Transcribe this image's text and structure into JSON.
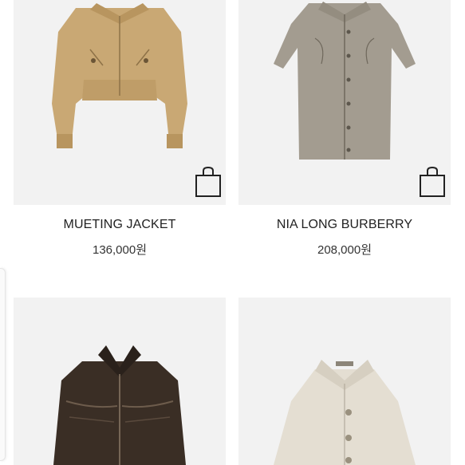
{
  "products": [
    {
      "name": "MUETING JACKET",
      "price": "136,000원",
      "image": "beige cropped jacket",
      "cart_icon": "shopping-bag-icon"
    },
    {
      "name": "NIA LONG BURBERRY",
      "price": "208,000원",
      "image": "grey long trench coat",
      "cart_icon": "shopping-bag-icon"
    },
    {
      "name": "",
      "price": "",
      "image": "dark brown leather jacket"
    },
    {
      "name": "",
      "price": "",
      "image": "ivory coat"
    }
  ],
  "colors": {
    "card_bg": "#f2f2f2",
    "text": "#222222"
  }
}
